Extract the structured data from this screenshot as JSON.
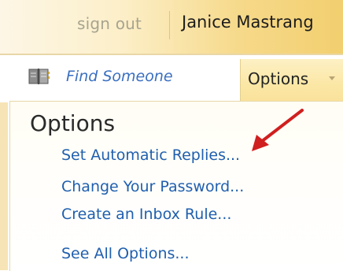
{
  "header": {
    "sign_out_label": "sign out",
    "user_name": "Janice Mastrang"
  },
  "nav": {
    "find_someone_label": "Find Someone",
    "find_someone_icon": "address-book-icon",
    "options_tab_label": "Options"
  },
  "options_menu": {
    "title": "Options",
    "items": [
      {
        "label": "Set Automatic Replies..."
      },
      {
        "label": "Change Your Password..."
      },
      {
        "label": "Create an Inbox Rule..."
      },
      {
        "label": "See All Options..."
      }
    ]
  },
  "annotation": {
    "arrow_color": "#d01f1f"
  },
  "colors": {
    "link": "#1f5fae",
    "header_gold": "#f2cf6f",
    "muted_text": "#a7a48f"
  }
}
